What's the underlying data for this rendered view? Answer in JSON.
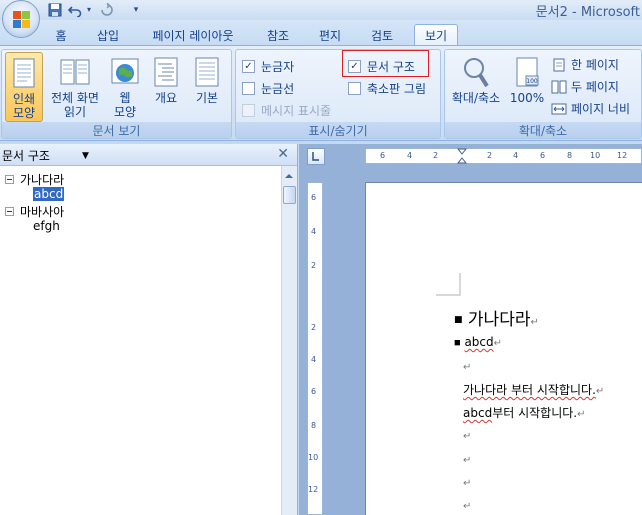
{
  "titlebar": {
    "app_title": "문서2 - Microsoft"
  },
  "quick_access": {
    "save_icon": "floppy-disk-icon",
    "undo_icon": "undo-icon",
    "redo_icon": "redo-icon",
    "customize_icon": "dropdown-arrow-icon"
  },
  "tabs": [
    {
      "label": "홈"
    },
    {
      "label": "삽입"
    },
    {
      "label": "페이지 레이아웃"
    },
    {
      "label": "참조"
    },
    {
      "label": "편지"
    },
    {
      "label": "검토"
    },
    {
      "label": "보기",
      "active": true
    }
  ],
  "ribbon": {
    "doc_views": {
      "label": "문서 보기",
      "buttons": [
        {
          "line1": "인쇄",
          "line2": "모양",
          "active": true
        },
        {
          "line1": "전체 화면",
          "line2": "읽기"
        },
        {
          "line1": "웹",
          "line2": "모양"
        },
        {
          "line1": "개요",
          "line2": ""
        },
        {
          "line1": "기본",
          "line2": ""
        }
      ]
    },
    "show_hide": {
      "label": "표시/숨기기",
      "ruler": {
        "label": "눈금자",
        "checked": true
      },
      "gridlines": {
        "label": "눈금선",
        "checked": false
      },
      "message_bar": {
        "label": "메시지 표시줄",
        "checked": false,
        "disabled": true
      },
      "doc_map": {
        "label": "문서 구조",
        "checked": true
      },
      "thumbnails": {
        "label": "축소판 그림",
        "checked": false
      }
    },
    "zoom": {
      "label": "확대/축소",
      "zoom_btn": "확대/축소",
      "hundred_btn": "100%",
      "one_page": "한 페이지",
      "two_pages": "두 페이지",
      "page_width": "페이지 너비"
    }
  },
  "docmap": {
    "dropdown_value": "문서 구조",
    "tree": [
      {
        "label": "가나다라",
        "level": 1,
        "expanded": true
      },
      {
        "label": "abcd",
        "level": 2,
        "selected": true
      },
      {
        "label": "마바사아",
        "level": 1,
        "expanded": true
      },
      {
        "label": "efgh",
        "level": 2
      }
    ]
  },
  "ruler": {
    "top_ticks": [
      "6",
      "4",
      "2",
      "2",
      "4",
      "6",
      "8",
      "10",
      "12"
    ],
    "left_ticks": [
      "6",
      "4",
      "2",
      "2",
      "4",
      "6",
      "8",
      "10",
      "12"
    ]
  },
  "document": {
    "heading1": "가나다라",
    "heading2": "abcd",
    "para_mark": "↵",
    "body1": "가나다라 부터 시작합니다.",
    "body2_word": "abcd",
    "body2_rest": "부터 시작합니다."
  }
}
